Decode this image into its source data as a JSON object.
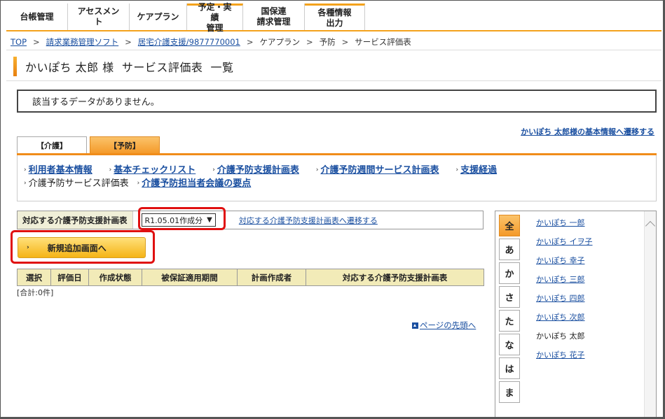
{
  "nav": {
    "items": [
      {
        "line1": "台帳管理",
        "line2": ""
      },
      {
        "line1": "アセスメント",
        "line2": ""
      },
      {
        "line1": "ケアプラン",
        "line2": ""
      },
      {
        "line1": "予定・実績",
        "line2": "管理"
      },
      {
        "line1": "国保連",
        "line2": "請求管理"
      },
      {
        "line1": "各種情報",
        "line2": "出力"
      }
    ]
  },
  "breadcrumb": {
    "top": "TOP",
    "software": "請求業務管理ソフト",
    "office": "居宅介護支援/9877770001",
    "care_plan": "ケアプラン",
    "prevention": "予防",
    "current": "サービス評価表",
    "sep": ">"
  },
  "page_title": "かいぽち 太郎 様  サービス評価表  一覧",
  "message": "該当するデータがありません。",
  "basic_info_link": "かいぽち 太郎様の基本情報へ遷移する",
  "tabs": {
    "care": "【介護】",
    "prevention": "【予防】"
  },
  "subnav": {
    "user_info": "利用者基本情報",
    "checklist": "基本チェックリスト",
    "support_plan": "介護予防支援計画表",
    "weekly_plan": "介護予防週間サービス計画表",
    "support_record": "支援経過",
    "service_eval": "介護予防サービス評価表",
    "meeting": "介護予防担当者会議の要点"
  },
  "plan_selector": {
    "label": "対応する介護予防支援計画表",
    "selected": "R1.05.01作成分",
    "link": "対応する介護予防支援計画表へ遷移する"
  },
  "add_button": "新規追加画面へ",
  "table": {
    "headers": [
      "選択",
      "評価日",
      "作成状態",
      "被保証適用期間",
      "計画作成者",
      "対応する介護予防支援計画表"
    ]
  },
  "total": "[合計:0件]",
  "page_top": "ページの先頭へ",
  "kana": [
    "全",
    "あ",
    "か",
    "さ",
    "た",
    "な",
    "は",
    "ま"
  ],
  "users": [
    {
      "name": "かいぽち 一郎",
      "link": true
    },
    {
      "name": "かいぽち イヲ子",
      "link": true
    },
    {
      "name": "かいぽち 幸子",
      "link": true
    },
    {
      "name": "かいぽち 三郎",
      "link": true
    },
    {
      "name": "かいぽち 四郎",
      "link": true
    },
    {
      "name": "かいぽち 次郎",
      "link": true
    },
    {
      "name": "かいぽち 太郎",
      "link": false
    },
    {
      "name": "かいぽち 花子",
      "link": true
    }
  ],
  "colors": {
    "accent_orange": "#f08c1a",
    "link_blue": "#1a4fa0",
    "highlight_red": "#e01010"
  }
}
